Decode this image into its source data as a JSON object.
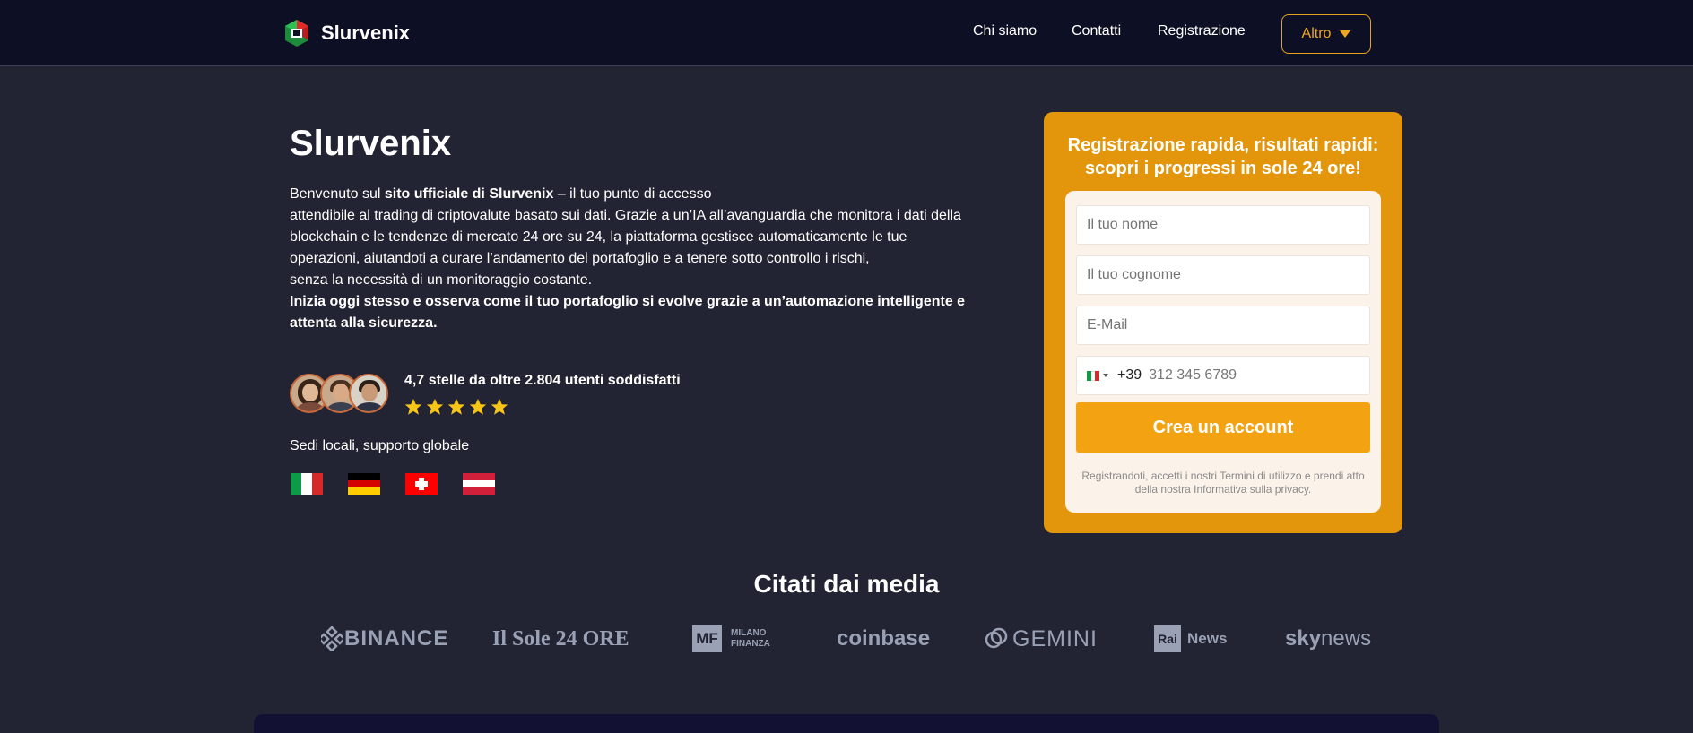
{
  "nav": {
    "brand": "Slurvenix",
    "links": [
      "Chi siamo",
      "Contatti",
      "Registrazione"
    ],
    "more_label": "Altro"
  },
  "hero": {
    "title": "Slurvenix",
    "p1_before": "Benvenuto sul ",
    "p1_bold": "sito ufficiale di Slurvenix",
    "p1_after": " – il tuo punto di accesso",
    "line2": "attendibile al trading di criptovalute basato sui dati. Grazie a un’IA all’avanguardia che monitora i dati della",
    "line3": "blockchain e le tendenze di mercato 24 ore su 24, la piattaforma gestisce automaticamente le tue",
    "line4": "operazioni, aiutandoti a curare l’andamento del portafoglio e a tenere sotto controllo i rischi,",
    "line5": "senza la necessità di un monitoraggio costante.",
    "cta_bold": "Inizia oggi stesso e osserva come il tuo portafoglio si evolve grazie a un’automazione intelligente e attenta alla sicurezza."
  },
  "rating": {
    "text": "4,7 stelle da oltre 2.804 utenti soddisfatti",
    "stars": 5,
    "star_color": "#f5c518"
  },
  "locations": {
    "text": "Sedi locali, supporto globale",
    "flags": [
      "italy-flag",
      "germany-flag",
      "switzerland-flag",
      "austria-flag"
    ]
  },
  "form": {
    "title": "Registrazione rapida, risultati rapidi: scopri i progressi in sole 24 ore!",
    "first_name_placeholder": "Il tuo nome",
    "last_name_placeholder": "Il tuo cognome",
    "email_placeholder": "E-Mail",
    "phone_code": "+39",
    "phone_placeholder": "312 345 6789",
    "submit_label": "Crea un account",
    "terms": "Registrandoti, accetti i nostri Termini di utilizzo e prendi atto della nostra Informativa sulla privacy."
  },
  "media": {
    "title": "Citati dai media",
    "binance": "BINANCE",
    "sole": "Il Sole 24 ORE",
    "mf_badge": "MF",
    "mf_line1": "MILANO",
    "mf_line2": "FINANZA",
    "coinbase": "coinbase",
    "gemini": "GEMINI",
    "rai_badge": "Rai",
    "rai_text": "News",
    "sky": "sky",
    "sky_news": "news"
  },
  "colors": {
    "nav_bg": "#0d0f24",
    "page_bg": "#232433",
    "accent": "#e3960c",
    "button": "#f3a212"
  }
}
